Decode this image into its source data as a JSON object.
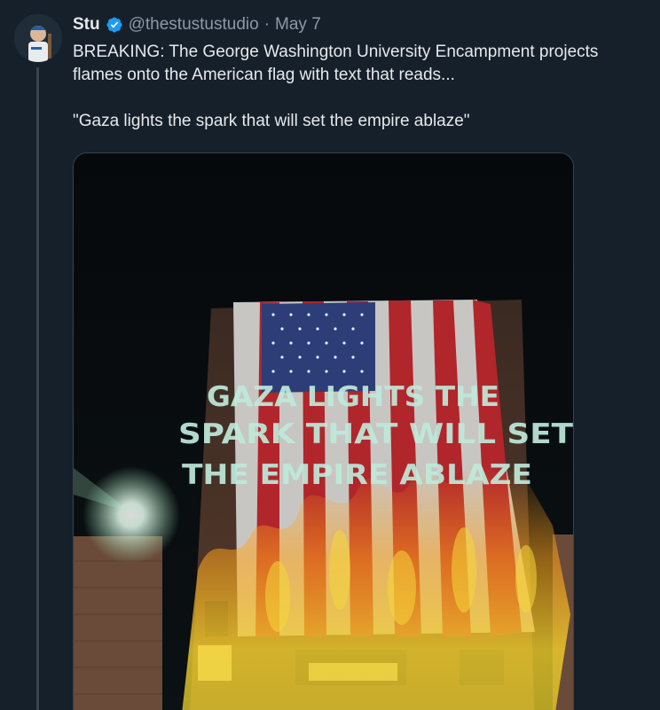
{
  "tweet": {
    "author": {
      "display_name": "Stu",
      "handle": "@thestustustudio",
      "verified": true
    },
    "separator": "·",
    "date": "May 7",
    "text_line1": "BREAKING: The George Washington University Encampment projects flames onto the American flag with text that reads...",
    "text_line2": "\"Gaza lights the spark that will set the empire ablaze\""
  },
  "media": {
    "projection_lines": [
      "GAZA LIGHTS THE",
      "SPARK THAT WILL SET",
      "THE EMPIRE ABLAZE"
    ]
  },
  "colors": {
    "background": "#15202b",
    "verified_badge": "#1d9bf0",
    "muted_text": "#8b98a5",
    "projection_text": "#bfeadb"
  }
}
